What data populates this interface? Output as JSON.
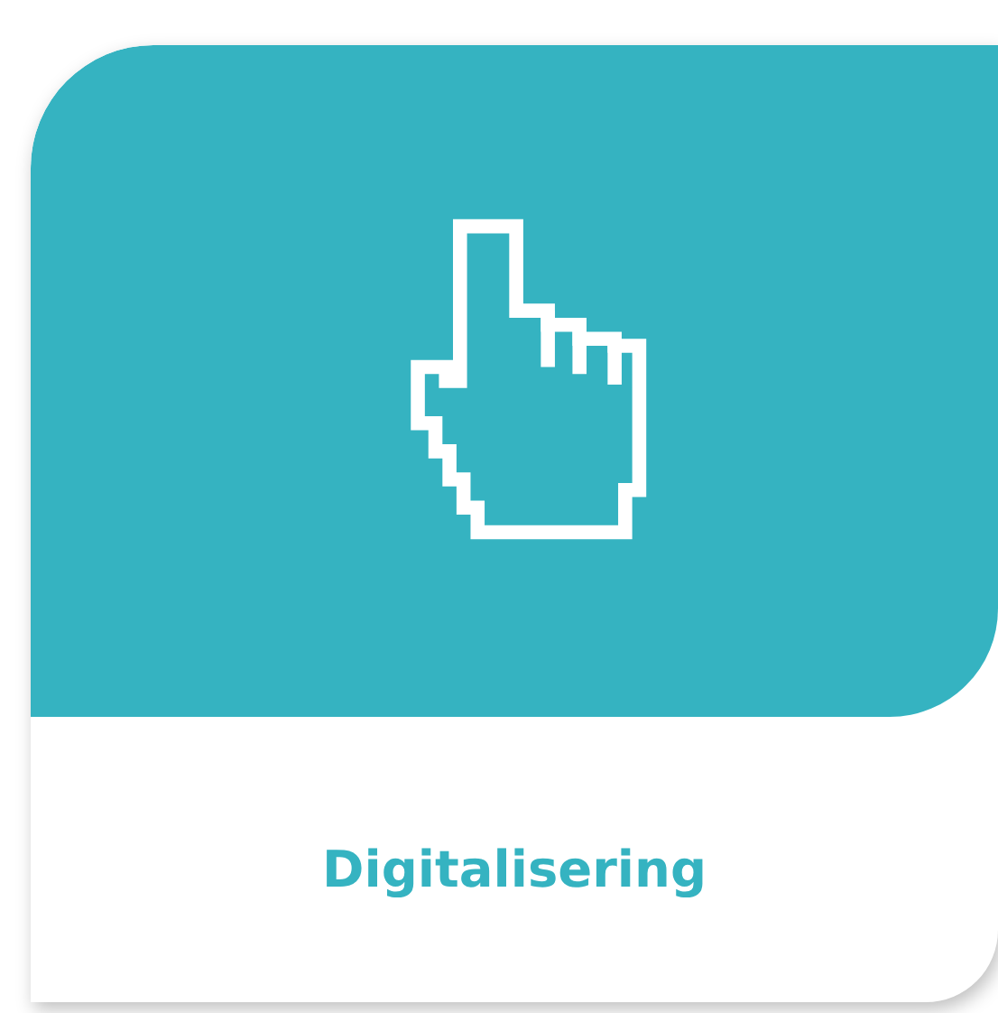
{
  "card": {
    "title": "Digitalisering"
  }
}
